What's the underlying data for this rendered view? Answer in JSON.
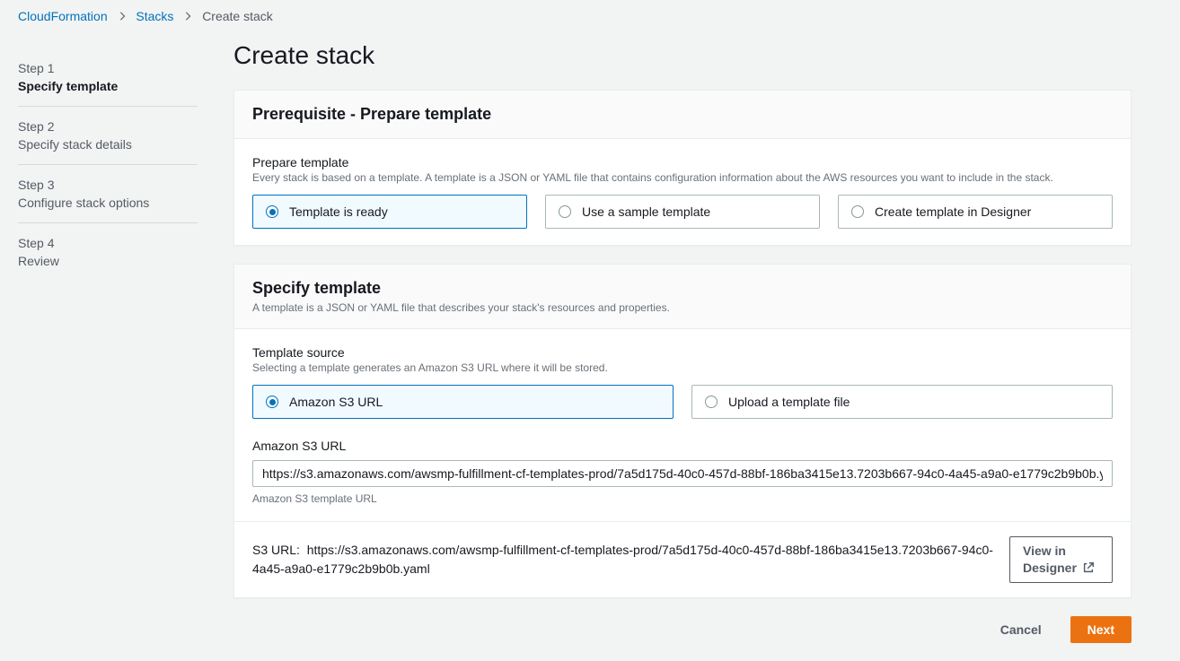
{
  "breadcrumb": {
    "item1": "CloudFormation",
    "item2": "Stacks",
    "item3": "Create stack"
  },
  "steps": [
    {
      "num": "Step 1",
      "label": "Specify template"
    },
    {
      "num": "Step 2",
      "label": "Specify stack details"
    },
    {
      "num": "Step 3",
      "label": "Configure stack options"
    },
    {
      "num": "Step 4",
      "label": "Review"
    }
  ],
  "page": {
    "title": "Create stack"
  },
  "prereq": {
    "header": "Prerequisite - Prepare template",
    "field_label": "Prepare template",
    "field_desc": "Every stack is based on a template. A template is a JSON or YAML file that contains configuration information about the AWS resources you want to include in the stack.",
    "opt1": "Template is ready",
    "opt2": "Use a sample template",
    "opt3": "Create template in Designer"
  },
  "specify": {
    "header": "Specify template",
    "desc": "A template is a JSON or YAML file that describes your stack's resources and properties.",
    "source_label": "Template source",
    "source_desc": "Selecting a template generates an Amazon S3 URL where it will be stored.",
    "opt1": "Amazon S3 URL",
    "opt2": "Upload a template file",
    "url_label": "Amazon S3 URL",
    "url_value": "https://s3.amazonaws.com/awsmp-fulfillment-cf-templates-prod/7a5d175d-40c0-457d-88bf-186ba3415e13.7203b667-94c0-4a45-a9a0-e1779c2b9b0b.yaml",
    "url_helper": "Amazon S3 template URL",
    "s3_prefix": "S3 URL:",
    "s3_url_display": "https://s3.amazonaws.com/awsmp-fulfillment-cf-templates-prod/7a5d175d-40c0-457d-88bf-186ba3415e13.7203b667-94c0-4a45-a9a0-e1779c2b9b0b.yaml",
    "view_designer_l1": "View in",
    "view_designer_l2": "Designer"
  },
  "actions": {
    "cancel": "Cancel",
    "next": "Next"
  }
}
